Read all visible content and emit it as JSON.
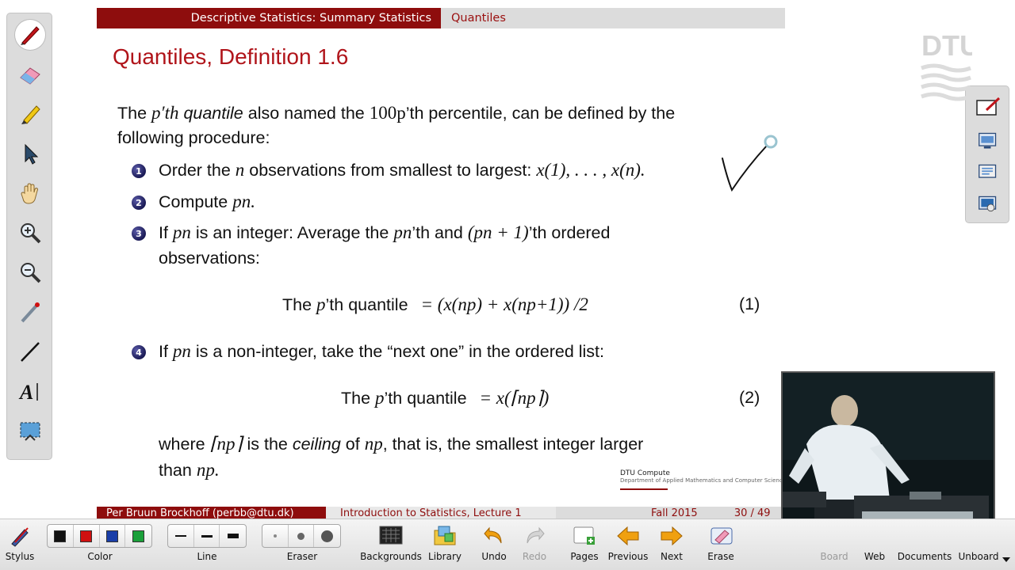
{
  "header": {
    "section": "Descriptive Statistics: Summary Statistics",
    "subsection": "Quantiles"
  },
  "slide": {
    "title": "Quantiles, Definition 1.6",
    "intro_1": "The ",
    "intro_pth": "p′th",
    "intro_quantile": "quantile",
    "intro_2": " also named the ",
    "intro_100p": "100p",
    "intro_3": "’th percentile, can be defined by the",
    "intro_4": "following procedure:",
    "items": [
      {
        "num": "1",
        "text_a": "Order the ",
        "math_n": "n",
        "text_b": " observations from smallest to largest: ",
        "math_seq": "x(1), . . . , x(n)."
      },
      {
        "num": "2",
        "text_a": "Compute ",
        "math": "pn."
      },
      {
        "num": "3",
        "text_a": "If ",
        "math_pn": "pn",
        "text_b": " is an integer: Average the ",
        "math_pn2": "pn",
        "text_c": "’th and ",
        "math_pn1": "(pn + 1)",
        "text_d": "’th ordered",
        "line2": "observations:"
      },
      {
        "num": "4",
        "text_a": "If ",
        "math_pn": "pn",
        "text_b": " is a non-integer, take the “next one” in the ordered list:"
      }
    ],
    "eq1_label": "The ",
    "eq1_p": "p",
    "eq1_rest": "’th quantile",
    "eq1_rhs": "= (x(np) + x(np+1)) /2",
    "eq1_num": "(1)",
    "eq2_label": "The ",
    "eq2_p": "p",
    "eq2_rest": "’th quantile",
    "eq2_rhs": "= x(⌈np⌉)",
    "eq2_num": "(2)",
    "where_1": "where ",
    "where_ceil": "⌈np⌉",
    "where_2": " is the ",
    "where_ceiling": "ceiling",
    "where_3": " of ",
    "where_np": "np",
    "where_4": ", that is, the smallest integer larger",
    "where_5": "than ",
    "where_np2": "np."
  },
  "footer": {
    "dtu_line1": "DTU Compute",
    "dtu_line2": "Department of Applied Mathematics and Computer Science",
    "author": "Per Bruun Brockhoff (perbb@dtu.dk)",
    "course": "Introduction to Statistics, Lecture 1",
    "term": "Fall 2015",
    "page": "30 / 49"
  },
  "logo_text": "DTU",
  "toolbar": {
    "stylus": "Stylus",
    "color": "Color",
    "line": "Line",
    "eraser": "Eraser",
    "backgrounds": "Backgrounds",
    "library": "Library",
    "undo": "Undo",
    "redo": "Redo",
    "pages": "Pages",
    "previous": "Previous",
    "next": "Next",
    "erase": "Erase",
    "board": "Board",
    "web": "Web",
    "documents": "Documents",
    "unboard": "Unboard"
  },
  "colors": {
    "accent": "#8e0d0d",
    "title": "#b0141a",
    "swatch_black": "#111111",
    "swatch_red": "#d01010",
    "swatch_blue": "#1a3ea8",
    "swatch_green": "#1aa03a"
  }
}
